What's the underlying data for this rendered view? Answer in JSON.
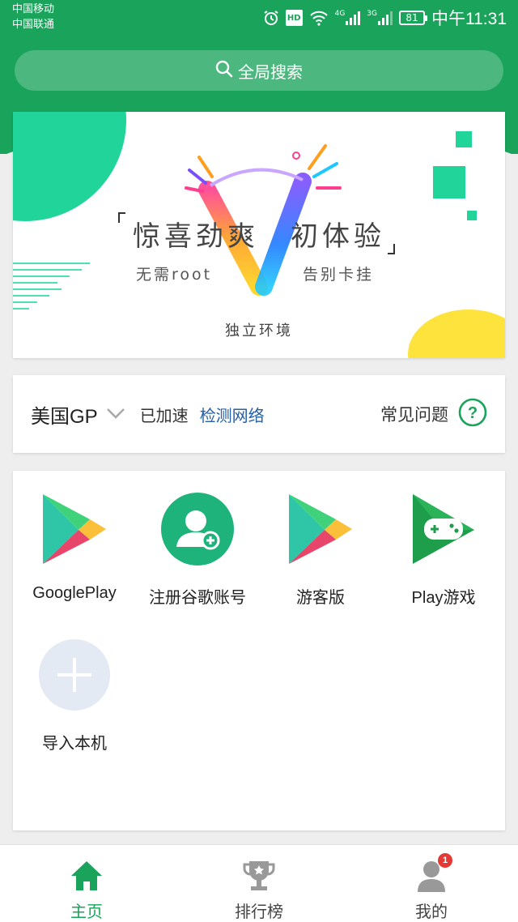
{
  "status_bar": {
    "carrier1": "中国移动",
    "carrier2": "中国联通",
    "hd": "HD",
    "network1": "4G",
    "network2": "3G",
    "battery": "81",
    "time": "中午11:31"
  },
  "search": {
    "label": "全局搜索",
    "icon": "search-icon"
  },
  "banner": {
    "headline": "惊喜劲爽　初体验",
    "left_sub": "无需root",
    "right_sub": "告别卡挂",
    "bottom": "独立环境"
  },
  "network": {
    "region": "美国GP",
    "status": "已加速",
    "detect": "检测网络",
    "faq": "常见问题"
  },
  "apps": [
    {
      "label": "GooglePlay",
      "icon": "google-play-icon"
    },
    {
      "label": "注册谷歌账号",
      "icon": "add-account-icon"
    },
    {
      "label": "游客版",
      "icon": "google-play-icon"
    },
    {
      "label": "Play游戏",
      "icon": "play-games-icon"
    },
    {
      "label": "导入本机",
      "icon": "plus-icon"
    }
  ],
  "nav": {
    "home": "主页",
    "ranking": "排行榜",
    "mine": "我的",
    "badge": "1"
  },
  "colors": {
    "brand_green": "#1aa35a",
    "accent_mint": "#21d49a",
    "link_blue": "#2560a8",
    "badge_red": "#e53935"
  }
}
